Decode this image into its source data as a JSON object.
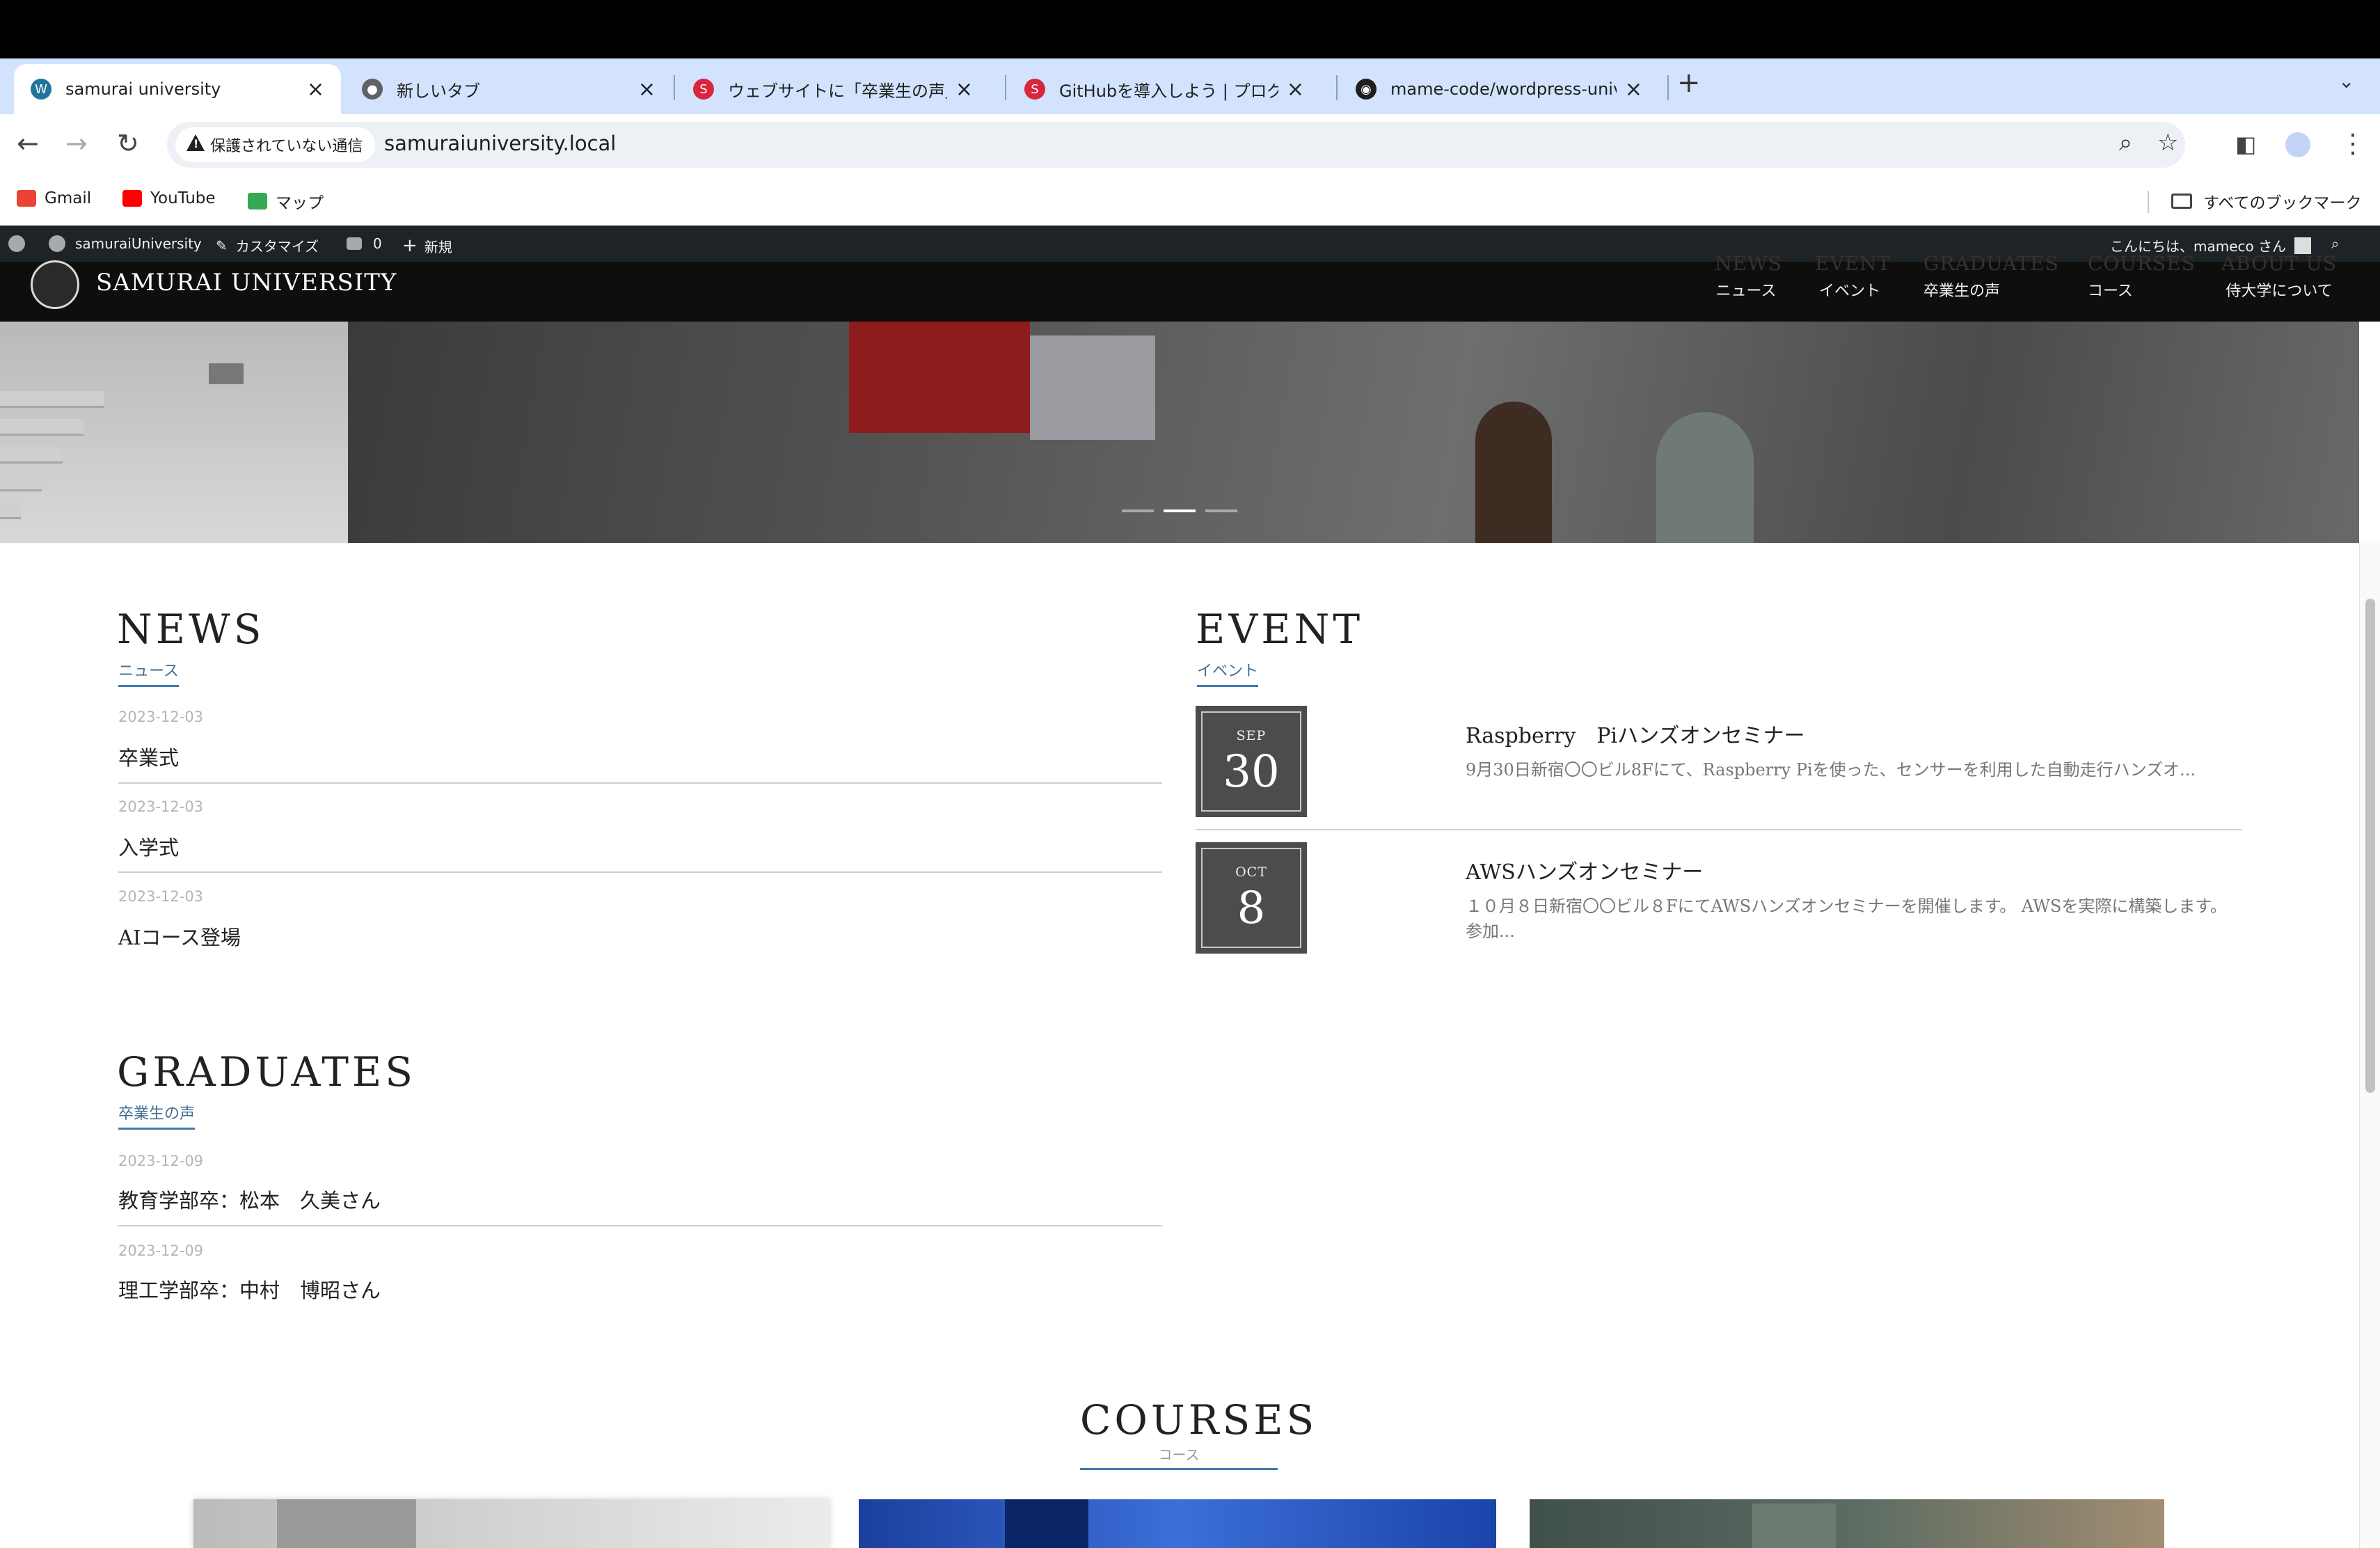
{
  "browser": {
    "tabs": [
      {
        "title": "samurai university",
        "active": true,
        "icon": "wordpress-icon"
      },
      {
        "title": "新しいタブ",
        "active": false,
        "icon": "chrome-icon"
      },
      {
        "title": "ウェブサイトに「卒業生の声」投",
        "active": false,
        "icon": "samurai-icon"
      },
      {
        "title": "GitHubを導入しよう | プログラミ",
        "active": false,
        "icon": "samurai-icon"
      },
      {
        "title": "mame-code/wordpress-unive",
        "active": false,
        "icon": "github-icon"
      }
    ],
    "new_tab": "+",
    "security_label": "保護されていない通信",
    "url": "samuraiuniversity.local",
    "bookmarks": [
      {
        "label": "Gmail",
        "color": "#ea4335"
      },
      {
        "label": "YouTube",
        "color": "#ff0000"
      },
      {
        "label": "マップ",
        "color": "#34a853"
      }
    ],
    "all_bookmarks": "すべてのブックマーク"
  },
  "admin_bar": {
    "site_name": "samuraiUniversity",
    "customize": "カスタマイズ",
    "comments_count": "0",
    "new_label": "新規",
    "greeting": "こんにちは、mameco さん"
  },
  "site": {
    "title": "SAMURAI UNIVERSITY",
    "nav": [
      {
        "en": "NEWS",
        "ja": "ニュース"
      },
      {
        "en": "EVENT",
        "ja": "イベント"
      },
      {
        "en": "GRADUATES",
        "ja": "卒業生の声"
      },
      {
        "en": "COURSES",
        "ja": "コース"
      },
      {
        "en": "ABOUT US",
        "ja": "侍大学について"
      }
    ]
  },
  "news": {
    "title": "NEWS",
    "subtitle": "ニュース",
    "items": [
      {
        "date": "2023-12-03",
        "title": "卒業式"
      },
      {
        "date": "2023-12-03",
        "title": "入学式"
      },
      {
        "date": "2023-12-03",
        "title": "AIコース登場"
      }
    ]
  },
  "event": {
    "title": "EVENT",
    "subtitle": "イベント",
    "items": [
      {
        "month": "SEP",
        "day": "30",
        "title": "Raspberry　Piハンズオンセミナー",
        "desc": "9月30日新宿〇〇ビル8Fにて、Raspberry Piを使った、センサーを利用した自動走行ハンズオ..."
      },
      {
        "month": "OCT",
        "day": "8",
        "title": "AWSハンズオンセミナー",
        "desc": "１０月８日新宿〇〇ビル８FにてAWSハンズオンセミナーを開催します。 AWSを実際に構築します。参加..."
      }
    ]
  },
  "graduates": {
    "title": "GRADUATES",
    "subtitle": "卒業生の声",
    "items": [
      {
        "date": "2023-12-09",
        "title": "教育学部卒：松本　久美さん"
      },
      {
        "date": "2023-12-09",
        "title": "理工学部卒：中村　博昭さん"
      }
    ]
  },
  "courses": {
    "title": "COURSES",
    "subtitle": "コース"
  },
  "hero": {
    "slide_count": 3,
    "active_slide": 2
  }
}
